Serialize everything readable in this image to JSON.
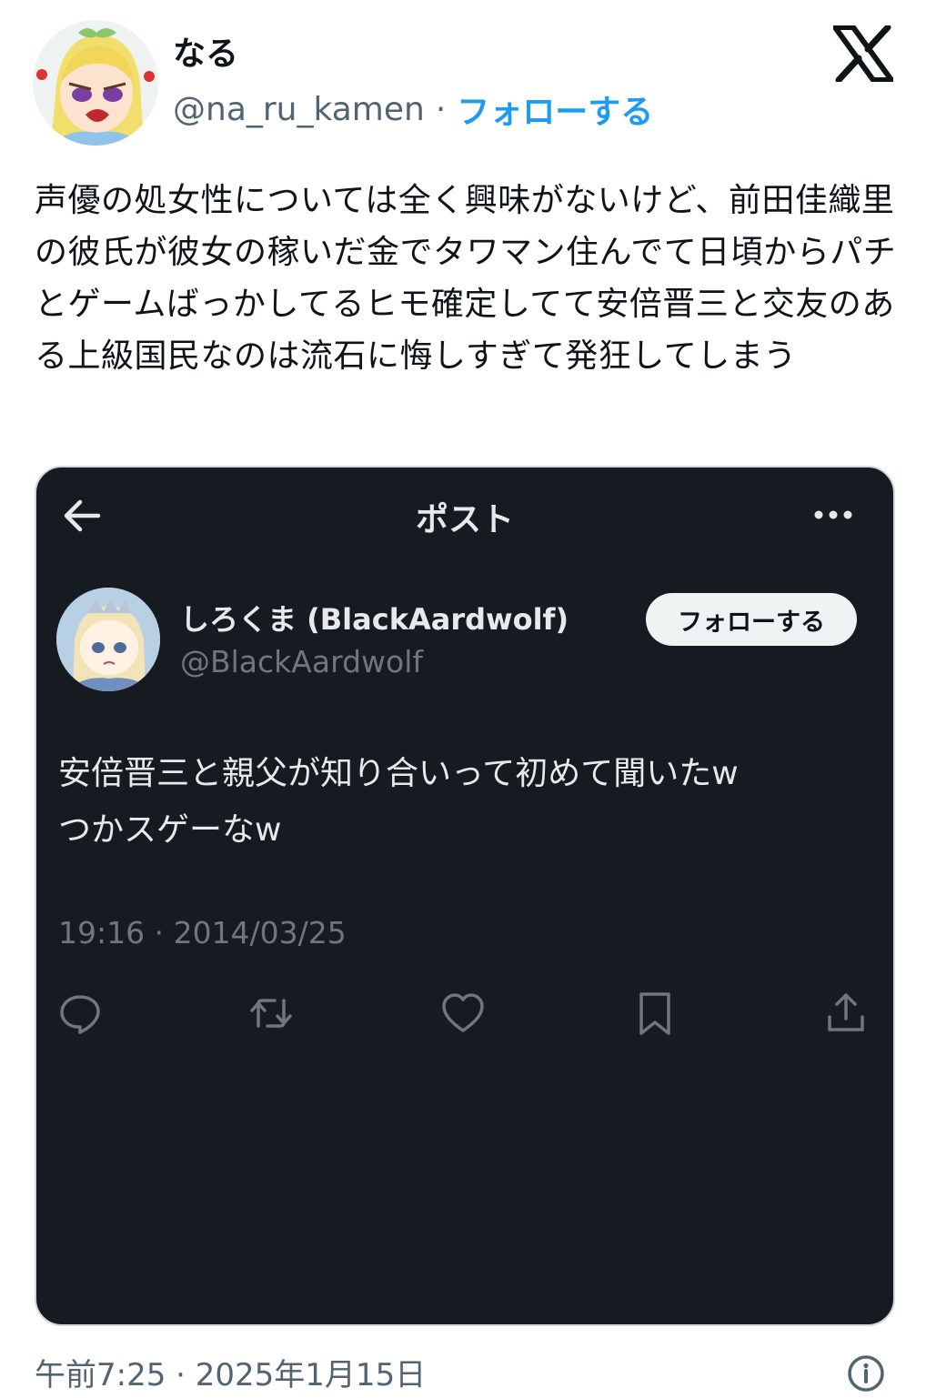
{
  "author": {
    "name": "なる",
    "handle": "@na_ru_kamen",
    "separator": "·",
    "follow_label": "フォローする"
  },
  "tweet": {
    "text": "声優の処女性については全く興味がないけど、前田佳織里の彼氏が彼女の稼いだ金でタワマン住んでて日頃からパチとゲームばっかしてるヒモ確定してて安倍晋三と交友のある上級国民なのは流石に悔しすぎて発狂してしまう"
  },
  "embedded_screenshot": {
    "header_title": "ポスト",
    "icons": [
      "arrow-left-icon",
      "more-icon"
    ],
    "quoted_author": {
      "name": "しろくま (BlackAardwolf)",
      "handle": "@BlackAardwolf",
      "follow_label": "フォローする"
    },
    "quoted_text_line1": "安倍晋三と親父が知り合いって初めて聞いたw",
    "quoted_text_line2": "つかスゲーなw",
    "timestamp": "19:16 · 2014/03/25",
    "actions": [
      "reply-icon",
      "retweet-icon",
      "like-icon",
      "bookmark-icon",
      "share-icon"
    ]
  },
  "footer": {
    "timestamp": "午前7:25 · 2025年1月15日",
    "icon": "info-icon"
  },
  "colors": {
    "link_blue": "#1d9bf0",
    "card_background": "#161b22",
    "secondary_text": "#536471"
  }
}
